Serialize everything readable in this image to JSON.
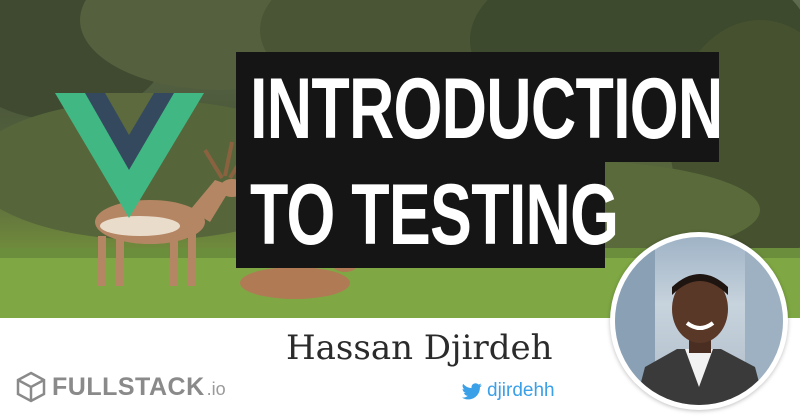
{
  "title": {
    "line1": "INTRODUCTION",
    "line2": "TO TESTING"
  },
  "author": {
    "name": "Hassan Djirdeh",
    "twitter_handle": "djirdehh"
  },
  "brand": {
    "name": "FULLSTACK",
    "tld": ".io"
  },
  "icons": {
    "framework_logo": "vue-logo-icon",
    "social": "twitter-bird-icon",
    "brand_logo": "fullstack-cube-icon"
  },
  "colors": {
    "vue_green": "#41b883",
    "vue_navy": "#34495e",
    "title_band": "#151515",
    "twitter_blue": "#3aa0e8",
    "brand_gray": "#8a8a8a",
    "author_text": "#2b2b2b"
  }
}
